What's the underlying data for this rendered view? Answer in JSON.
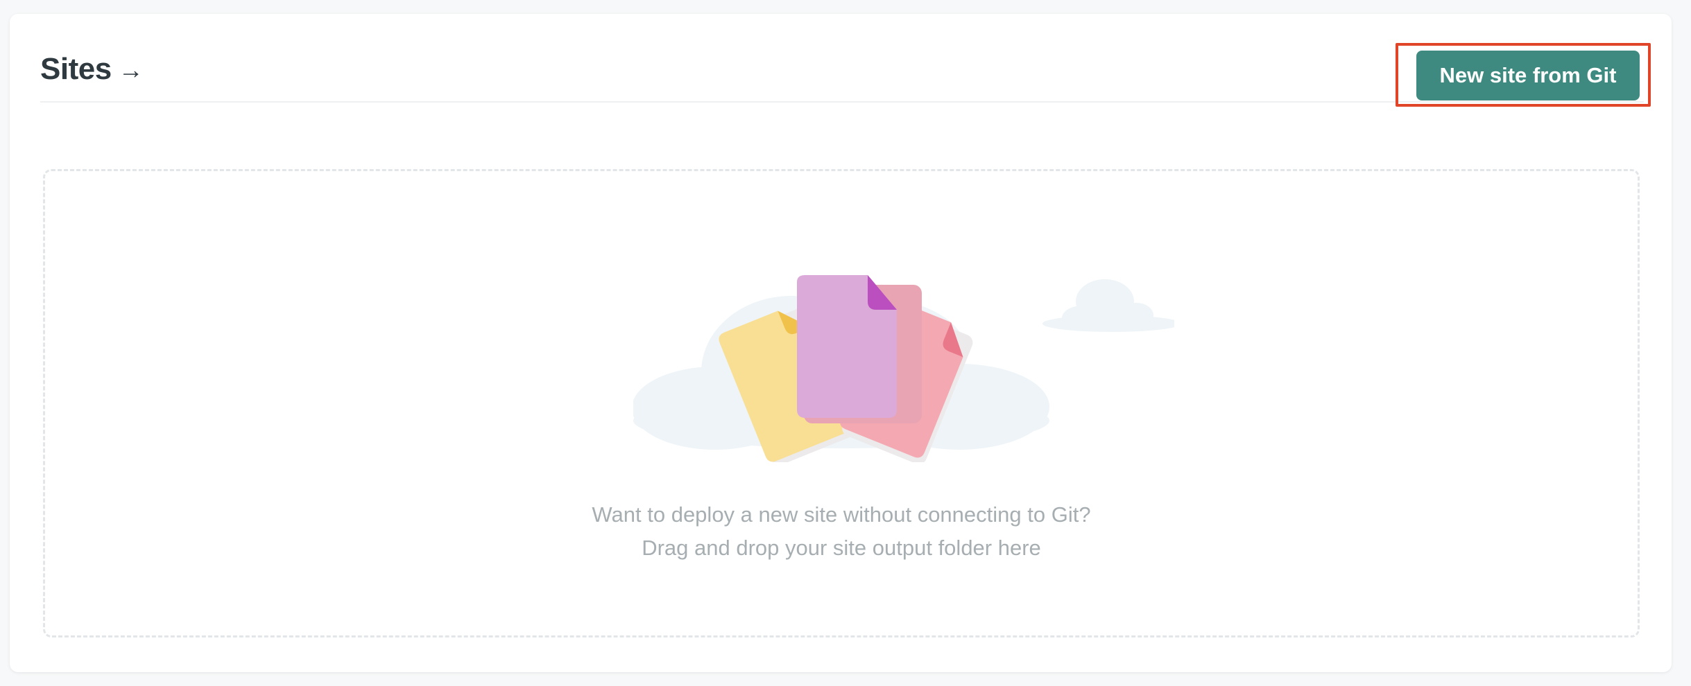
{
  "header": {
    "title": "Sites",
    "title_icon": "arrow-right-icon",
    "arrow_glyph": "→"
  },
  "actions": {
    "new_site_label": "New site from Git"
  },
  "dropzone": {
    "line1": "Want to deploy a new site without connecting to Git?",
    "line2": "Drag and drop your site output folder here",
    "illustration": "files-and-clouds-illustration"
  },
  "colors": {
    "accent": "#3f8a80",
    "highlight_border": "#e0452a",
    "title_text": "#2e3a40",
    "muted_text": "#a7aeb1",
    "file_yellow": "#f9df94",
    "file_purple": "#dbaad9",
    "file_pink": "#f4a9b2"
  }
}
